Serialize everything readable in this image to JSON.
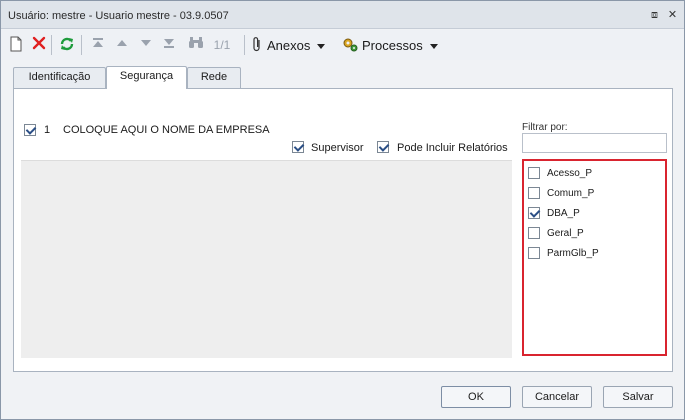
{
  "window": {
    "title": "Usuário: mestre - Usuario mestre - 03.9.0507",
    "restore_glyph": "⧈",
    "close_glyph": "✕"
  },
  "toolbar": {
    "new_icon": "document-icon",
    "delete_icon": "delete-icon",
    "refresh_icon": "refresh-icon",
    "first_icon": "first-record-icon",
    "prev_icon": "previous-record-icon",
    "next_icon": "next-record-icon",
    "last_icon": "last-record-icon",
    "find_icon": "binoculars-icon",
    "record_position": "1/1",
    "anexos_label": "Anexos",
    "processos_label": "Processos"
  },
  "tabs": [
    {
      "label": "Identificação"
    },
    {
      "label": "Segurança",
      "active": true
    },
    {
      "label": "Rede"
    }
  ],
  "security": {
    "company": {
      "checked": true,
      "number": "1",
      "name": "COLOQUE AQUI O NOME DA EMPRESA"
    },
    "supervisor": {
      "label": "Supervisor",
      "checked": true
    },
    "reports": {
      "label": "Pode Incluir Relatórios",
      "checked": true
    }
  },
  "filter": {
    "label": "Filtrar por:",
    "value": "",
    "highlight_color": "#d9242f",
    "items": [
      {
        "label": "Acesso_P",
        "checked": false
      },
      {
        "label": "Comum_P",
        "checked": false
      },
      {
        "label": "DBA_P",
        "checked": true
      },
      {
        "label": "Geral_P",
        "checked": false
      },
      {
        "label": "ParmGlb_P",
        "checked": false
      }
    ]
  },
  "buttons": {
    "ok": "OK",
    "cancel": "Cancelar",
    "save": "Salvar"
  }
}
